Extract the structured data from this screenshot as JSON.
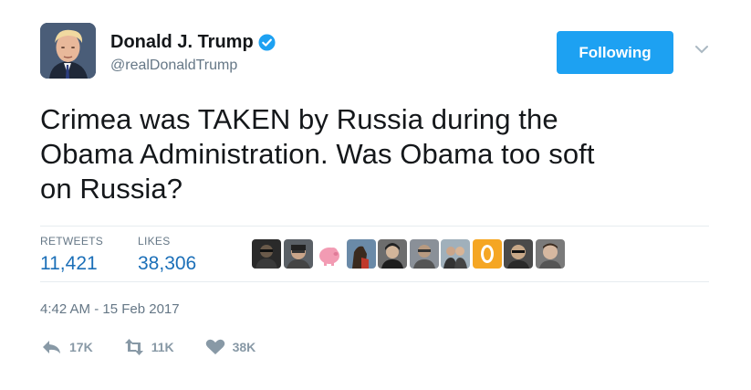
{
  "author": {
    "name": "Donald J. Trump",
    "handle": "@realDonaldTrump",
    "verified": true,
    "avatar_icon": "profile-photo"
  },
  "follow_button": {
    "label": "Following",
    "color": "#1da1f2"
  },
  "tweet": {
    "text_lines": [
      "Crimea was TAKEN by Russia during the",
      "Obama Administration. Was Obama too soft",
      "on Russia?"
    ]
  },
  "stats": {
    "retweets_label": "RETWEETS",
    "retweets_value": "11,421",
    "likes_label": "LIKES",
    "likes_value": "38,306"
  },
  "likers_count_shown": 10,
  "timestamp": "4:42 AM - 15 Feb 2017",
  "actions": {
    "reply_count": "17K",
    "retweet_count": "11K",
    "like_count": "38K"
  },
  "colors": {
    "text": "#14171a",
    "muted": "#657786",
    "link": "#1b6fb8",
    "action": "#8899a6"
  }
}
